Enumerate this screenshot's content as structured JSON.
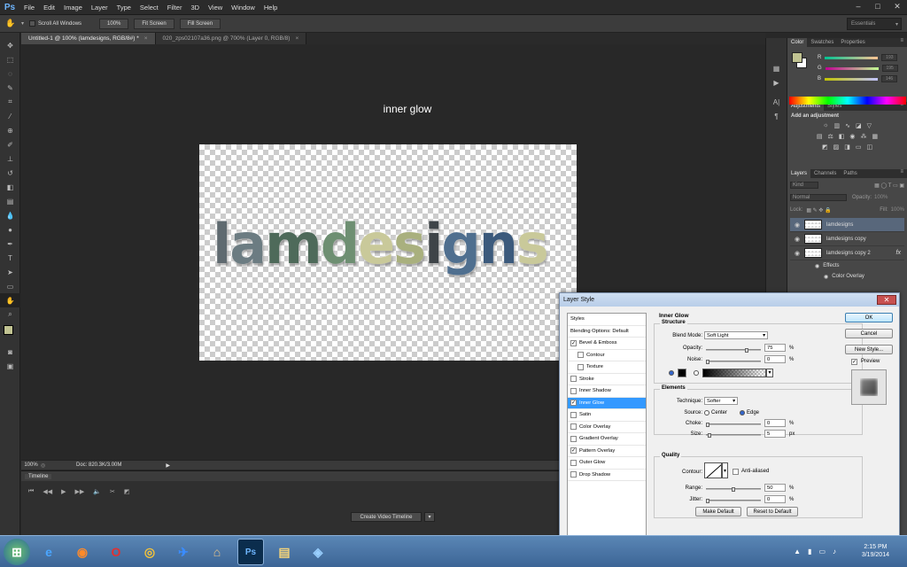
{
  "menubar": {
    "logo": "Ps",
    "items": [
      "File",
      "Edit",
      "Image",
      "Layer",
      "Type",
      "Select",
      "Filter",
      "3D",
      "View",
      "Window",
      "Help"
    ]
  },
  "options": {
    "scroll_all": "Scroll All Windows",
    "zoom100": "100%",
    "fit_screen": "Fit Screen",
    "fill_screen": "Fill Screen",
    "workspace": "Essentials"
  },
  "tabs": [
    "Untitled-1 @ 100% (lamdesigns, RGB/8#) *",
    "020_zps02107a36.png @ 700% (Layer 0, RGB/8)"
  ],
  "canvas": {
    "label": "inner glow",
    "logo_text": "lamdesigns"
  },
  "status": {
    "zoom": "100%",
    "doc": "Doc: 820.3K/3.00M"
  },
  "timeline": {
    "title": "Timeline",
    "create_button": "Create Video Timeline"
  },
  "color_panel": {
    "tabs": [
      "Color",
      "Swatches",
      "Properties"
    ],
    "channels": [
      {
        "label": "R",
        "value": "193"
      },
      {
        "label": "G",
        "value": "195"
      },
      {
        "label": "B",
        "value": "146"
      }
    ],
    "fg_color": "#c1c392"
  },
  "adjustments": {
    "tabs": [
      "Adjustments",
      "Styles"
    ],
    "heading": "Add an adjustment"
  },
  "layers_panel": {
    "tabs": [
      "Layers",
      "Channels",
      "Paths"
    ],
    "kind": "Kind",
    "blend": "Normal",
    "opacity_label": "Opacity:",
    "opacity": "100%",
    "lock_label": "Lock:",
    "fill_label": "Fill:",
    "fill": "100%",
    "layers": [
      {
        "name": "lamdesigns",
        "selected": true
      },
      {
        "name": "lamdesigns copy",
        "selected": false
      },
      {
        "name": "lamdesigns copy 2",
        "selected": false,
        "fx": "fx"
      }
    ],
    "effects_label": "Effects",
    "effect_item": "Color Overlay"
  },
  "dialog": {
    "title": "Layer Style",
    "styles": [
      {
        "label": "Styles",
        "check": false,
        "plain": true
      },
      {
        "label": "Blending Options: Default",
        "check": false,
        "plain": true
      },
      {
        "label": "Bevel & Emboss",
        "check": true
      },
      {
        "label": "Contour",
        "check": false,
        "indent": true
      },
      {
        "label": "Texture",
        "check": false,
        "indent": true
      },
      {
        "label": "Stroke",
        "check": false
      },
      {
        "label": "Inner Shadow",
        "check": false
      },
      {
        "label": "Inner Glow",
        "check": true,
        "sel": true
      },
      {
        "label": "Satin",
        "check": false
      },
      {
        "label": "Color Overlay",
        "check": false
      },
      {
        "label": "Gradient Overlay",
        "check": false
      },
      {
        "label": "Pattern Overlay",
        "check": true
      },
      {
        "label": "Outer Glow",
        "check": false
      },
      {
        "label": "Drop Shadow",
        "check": false
      }
    ],
    "section": "Inner Glow",
    "structure": "Structure",
    "blend_mode_label": "Blend Mode:",
    "blend_mode": "Soft Light",
    "opacity_label": "Opacity:",
    "opacity": "75",
    "noise_label": "Noise:",
    "noise": "0",
    "pct": "%",
    "elements": "Elements",
    "technique_label": "Technique:",
    "technique": "Softer",
    "source_label": "Source:",
    "center": "Center",
    "edge": "Edge",
    "choke_label": "Choke:",
    "choke": "0",
    "size_label": "Size:",
    "size": "5",
    "px": "px",
    "quality": "Quality",
    "contour_label": "Contour:",
    "anti_aliased": "Anti-aliased",
    "range_label": "Range:",
    "range": "50",
    "jitter_label": "Jitter:",
    "jitter": "0",
    "make_default": "Make Default",
    "reset_default": "Reset to Default",
    "ok": "OK",
    "cancel": "Cancel",
    "new_style": "New Style...",
    "preview": "Preview"
  },
  "taskbar": {
    "time": "2:15 PM",
    "date": "3/19/2014"
  },
  "colors": {
    "accent": "#3399ff"
  }
}
